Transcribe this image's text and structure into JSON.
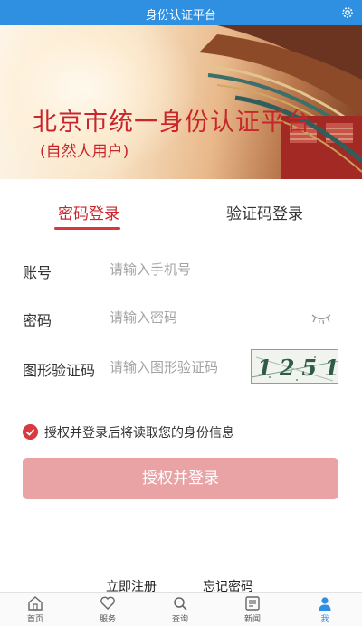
{
  "header": {
    "title": "身份认证平台",
    "settings_icon": "gear-icon"
  },
  "banner": {
    "title": "北京市统一身份认证平台",
    "subtitle": "(自然人用户)"
  },
  "tabs": [
    {
      "label": "密码登录",
      "active": true
    },
    {
      "label": "验证码登录",
      "active": false
    }
  ],
  "form": {
    "account": {
      "label": "账号",
      "placeholder": "请输入手机号",
      "value": ""
    },
    "password": {
      "label": "密码",
      "placeholder": "请输入密码",
      "value": "",
      "toggle_icon": "eye-closed-icon"
    },
    "captcha": {
      "label": "图形验证码",
      "placeholder": "请输入图形验证码",
      "value": "",
      "image_text": "1251"
    }
  },
  "consent": {
    "checked": true,
    "text": "授权并登录后将读取您的身份信息"
  },
  "login_button": {
    "label": "授权并登录"
  },
  "links": {
    "register": "立即注册",
    "forgot": "忘记密码"
  },
  "bottom_nav": [
    {
      "label": "首页",
      "icon": "home-icon",
      "active": false
    },
    {
      "label": "服务",
      "icon": "heart-icon",
      "active": false
    },
    {
      "label": "查询",
      "icon": "search-icon",
      "active": false
    },
    {
      "label": "新闻",
      "icon": "news-icon",
      "active": false
    },
    {
      "label": "我",
      "icon": "user-icon",
      "active": true
    }
  ],
  "colors": {
    "header_blue": "#2f8fe0",
    "accent_red": "#c8262b",
    "button_pink": "#e9a3a5"
  }
}
